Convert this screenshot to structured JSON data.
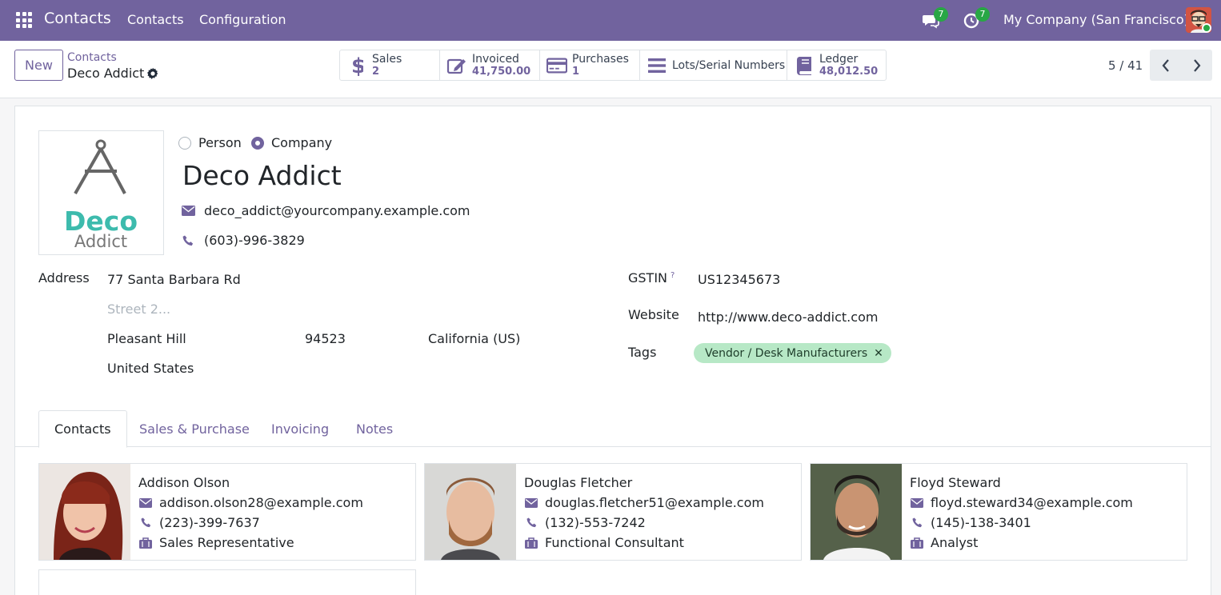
{
  "navbar": {
    "app_name": "Contacts",
    "menu": [
      "Contacts",
      "Configuration"
    ],
    "messages_count": "7",
    "activities_count": "7",
    "company": "My Company (San Francisco)",
    "accent": "#71639e"
  },
  "control": {
    "new_label": "New",
    "breadcrumb_parent": "Contacts",
    "breadcrumb_current": "Deco Addict",
    "stat_buttons": [
      {
        "icon": "dollar-icon",
        "label": "Sales",
        "value": "2"
      },
      {
        "icon": "edit-invoice-icon",
        "label": "Invoiced",
        "value": "41,750.00"
      },
      {
        "icon": "credit-card-icon",
        "label": "Purchases",
        "value": "1"
      },
      {
        "icon": "list-icon",
        "label": "Lots/Serial Numbers",
        "value": ""
      },
      {
        "icon": "book-icon",
        "label": "Ledger",
        "value": "48,012.50"
      }
    ],
    "pager": "5 / 41"
  },
  "form": {
    "type_options": [
      "Person",
      "Company"
    ],
    "selected_type": "Company",
    "logo_text_1": "Deco",
    "logo_text_2": "Addict",
    "name": "Deco Addict",
    "email": "deco_addict@yourcompany.example.com",
    "phone": "(603)-996-3829",
    "address_label": "Address",
    "street": "77 Santa Barbara Rd",
    "street2_placeholder": "Street 2...",
    "city": "Pleasant Hill",
    "zip": "94523",
    "state": "California (US)",
    "country": "United States",
    "gstin_label": "GSTIN",
    "gstin_help": "?",
    "gstin": "US12345673",
    "website_label": "Website",
    "website": "http://www.deco-addict.com",
    "tags_label": "Tags",
    "tag": "Vendor / Desk Manufacturers"
  },
  "tabs": [
    "Contacts",
    "Sales & Purchase",
    "Invoicing",
    "Notes"
  ],
  "contacts": [
    {
      "name": "Addison Olson",
      "email": "addison.olson28@example.com",
      "phone": "(223)-399-7637",
      "job": "Sales Representative"
    },
    {
      "name": "Douglas Fletcher",
      "email": "douglas.fletcher51@example.com",
      "phone": "(132)-553-7242",
      "job": "Functional Consultant"
    },
    {
      "name": "Floyd Steward",
      "email": "floyd.steward34@example.com",
      "phone": "(145)-138-3401",
      "job": "Analyst"
    }
  ]
}
